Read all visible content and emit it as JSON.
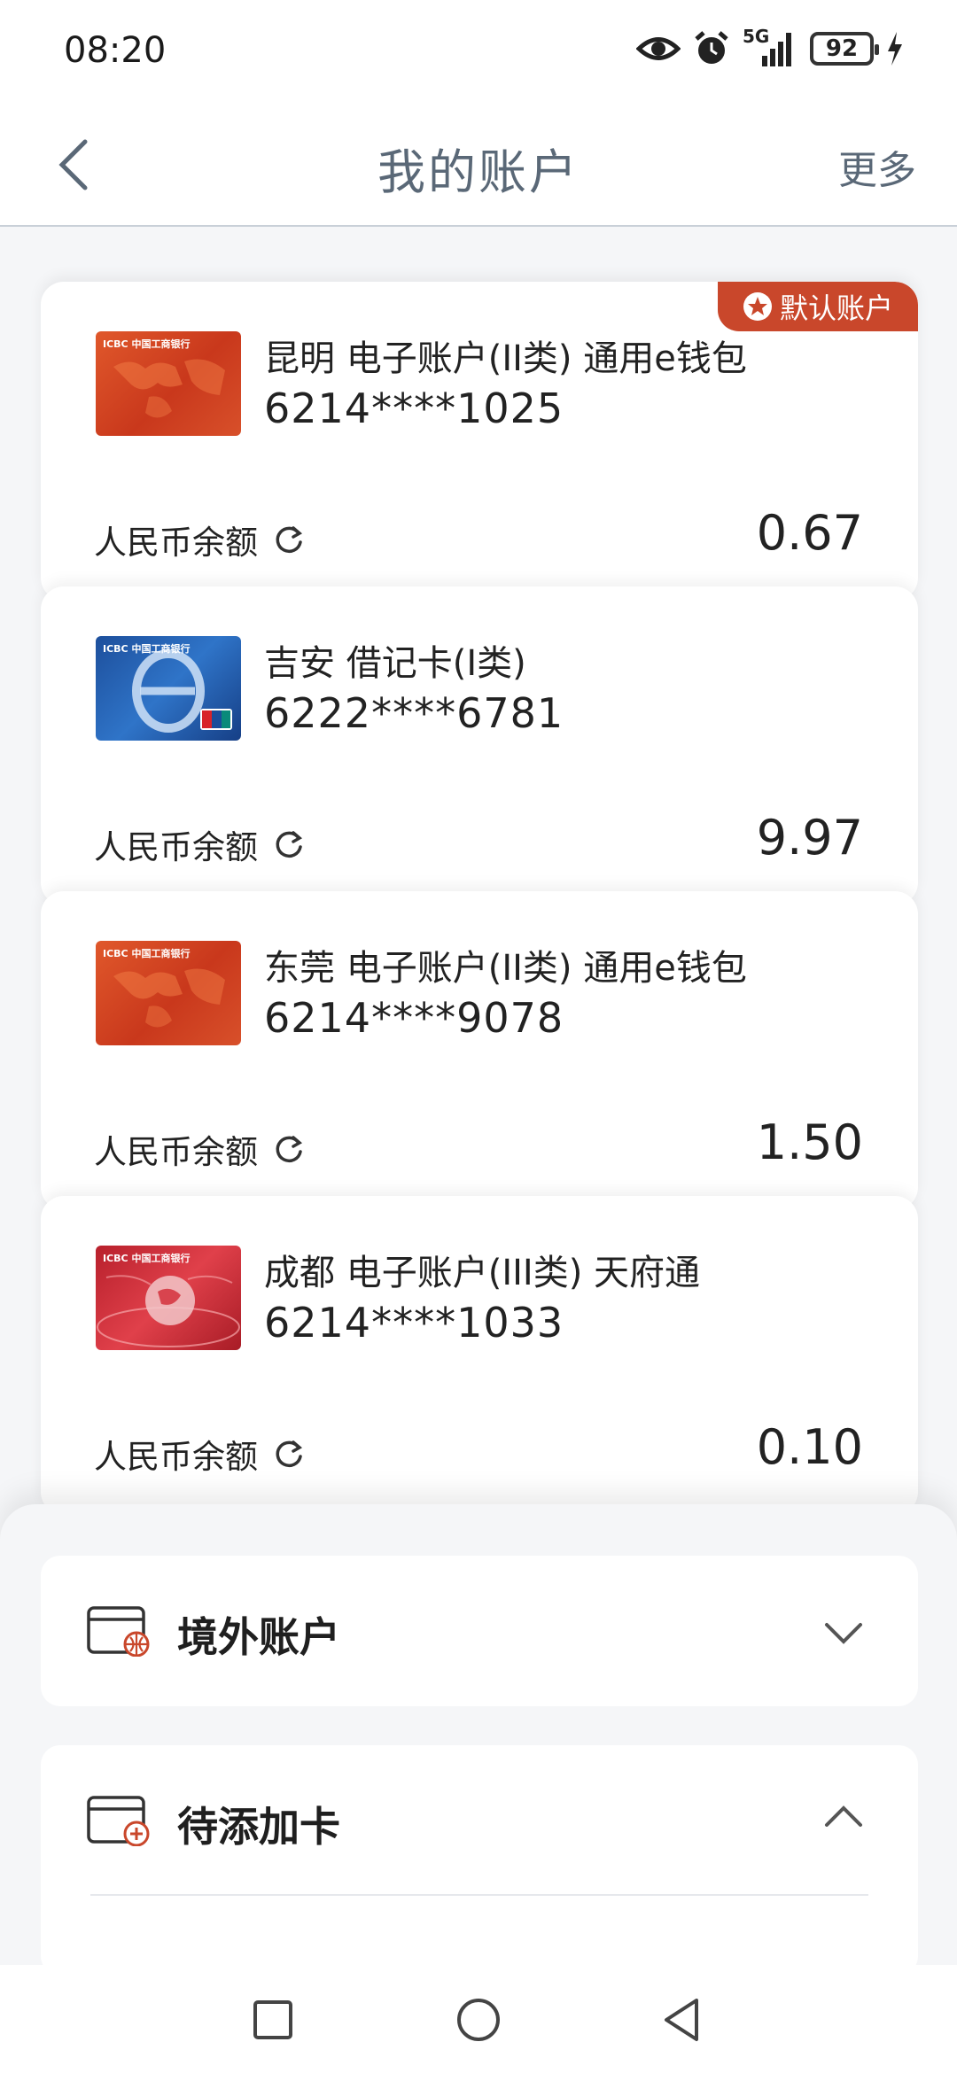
{
  "status_bar": {
    "time": "08:20",
    "signal_label": "5G",
    "battery": "92",
    "icons": [
      "eye-icon",
      "alarm-icon",
      "signal-icon",
      "battery-icon",
      "charging-icon"
    ]
  },
  "header": {
    "title": "我的账户",
    "more": "更多",
    "back_icon": "chevron-left-icon"
  },
  "accounts": [
    {
      "name": "昆明 电子账户(II类) 通用e钱包",
      "number": "6214****1025",
      "balance_label": "人民币余额",
      "balance": "0.67",
      "default_badge": "默认账户",
      "card_style": "orange-world"
    },
    {
      "name": "吉安 借记卡(I类)",
      "number": "6222****6781",
      "balance_label": "人民币余额",
      "balance": "9.97",
      "card_style": "blue-e"
    },
    {
      "name": "东莞 电子账户(II类) 通用e钱包",
      "number": "6214****9078",
      "balance_label": "人民币余额",
      "balance": "1.50",
      "card_style": "orange-world"
    },
    {
      "name": "成都 电子账户(III类) 天府通",
      "number": "6214****1033",
      "balance_label": "人民币余额",
      "balance": "0.10",
      "card_style": "red-globe"
    }
  ],
  "sections": {
    "overseas": {
      "title": "境外账户",
      "icon": "card-globe-icon",
      "state": "collapsed"
    },
    "pending": {
      "title": "待添加卡",
      "icon": "card-add-icon",
      "state": "expanded"
    }
  },
  "nav": [
    "recents-square-icon",
    "home-circle-icon",
    "back-triangle-icon"
  ],
  "colors": {
    "accent_red": "#c9472b",
    "title_grey": "#5a6877",
    "page_bg": "#f5f6f8"
  }
}
